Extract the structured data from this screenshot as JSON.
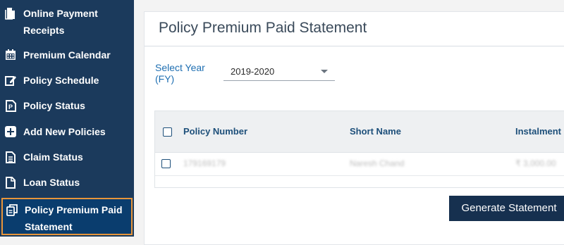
{
  "sidebar": {
    "items": [
      {
        "label_line1": "Online Payment",
        "label_line2": "Receipts",
        "icon": "receipt-icon"
      },
      {
        "label": "Premium Calendar",
        "icon": "calendar-icon"
      },
      {
        "label": "Policy Schedule",
        "icon": "edit-icon"
      },
      {
        "label": "Policy Status",
        "icon": "document-p-icon"
      },
      {
        "label": "Add New Policies",
        "icon": "plus-box-icon"
      },
      {
        "label": "Claim Status",
        "icon": "document-icon"
      },
      {
        "label": "Loan Status",
        "icon": "file-icon"
      },
      {
        "label_line1": "Policy Premium Paid",
        "label_line2": "Statement",
        "icon": "copy-icon",
        "active": true
      }
    ]
  },
  "main": {
    "title": "Policy Premium Paid Statement",
    "year_label_line1": "Select Year",
    "year_label_line2": "(FY)",
    "year_value": "2019-2020",
    "table": {
      "headers": [
        "Policy Number",
        "Short Name",
        "Instalment"
      ],
      "rows": [
        {
          "policy_number": "179169179",
          "short_name": "Naresh Chand",
          "instalment": "₹ 3,000.00"
        }
      ]
    },
    "generate_label": "Generate Statement"
  },
  "colors": {
    "sidebar_bg": "#1b3a5c",
    "active_border": "#e8953a",
    "button_bg": "#16304f",
    "accent_text": "#1f6fb2"
  }
}
